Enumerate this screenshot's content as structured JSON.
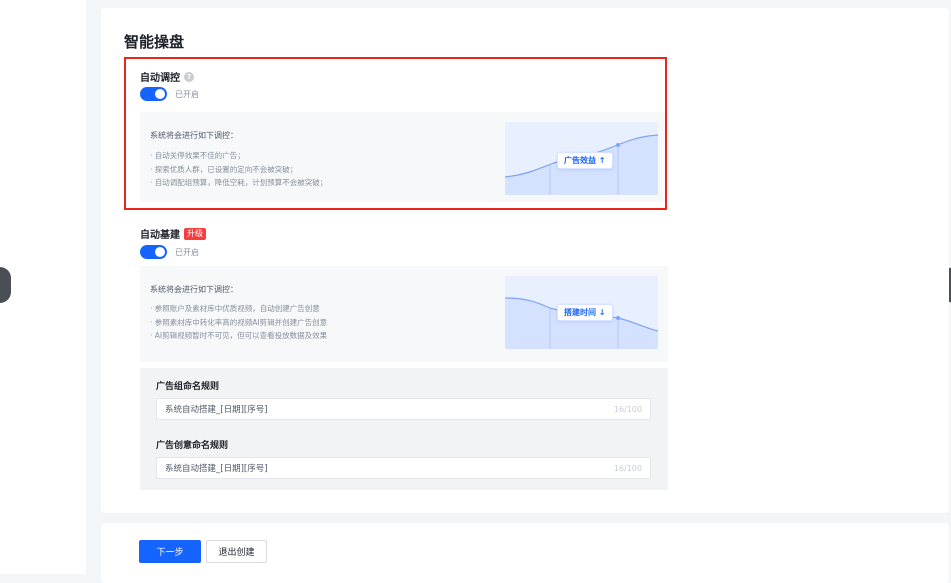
{
  "page": {
    "title": "智能操盘"
  },
  "auto_control": {
    "title": "自动调控",
    "help_icon": "question-circle-icon",
    "toggle_on": true,
    "toggle_label": "已开启",
    "info_heading": "系统将会进行如下调控：",
    "info_items": [
      "自动关停效果不佳的广告；",
      "探索优质人群，已设置的定向不会被突破；",
      "自动调配组预算，降低空耗，计划预算不会被突破；"
    ],
    "illustration_label": "广告效益 ↑"
  },
  "auto_build": {
    "title": "自动基建",
    "badge": "升级",
    "toggle_on": true,
    "toggle_label": "已开启",
    "info_heading": "系统将会进行如下调控：",
    "info_items": [
      "参照账户及素材库中优质视频，自动创建广告创意",
      "参照素材库中转化率高的视频AI剪辑并创建广告创意",
      "AI剪辑视频暂时不可见，但可以查看投放数据及效果"
    ],
    "illustration_label": "搭建时间 ↓"
  },
  "naming": {
    "group_rule_label": "广告组命名规则",
    "group_rule_value": "系统自动搭建_[日期][序号]",
    "group_rule_count": "16/100",
    "creative_rule_label": "广告创意命名规则",
    "creative_rule_value": "系统自动搭建_[日期][序号]",
    "creative_rule_count": "16/100"
  },
  "footer": {
    "next_label": "下一步",
    "exit_label": "退出创建"
  },
  "colors": {
    "primary": "#1664ff",
    "highlight": "#e8261a",
    "badge": "#f53f3f"
  }
}
